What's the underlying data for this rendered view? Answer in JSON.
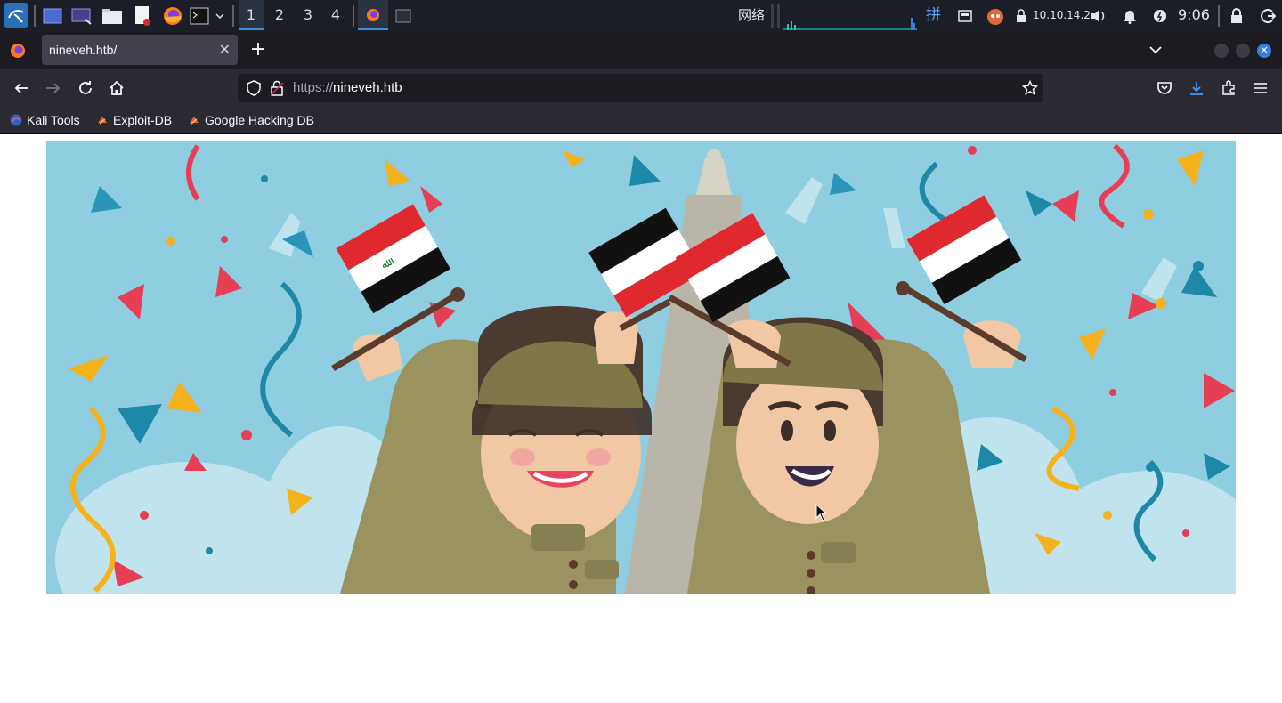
{
  "taskbar": {
    "workspaces": [
      "1",
      "2",
      "3",
      "4"
    ],
    "active_workspace": "1",
    "network_label": "网络",
    "input_method": "拼",
    "ip_address": "10.10.14.2",
    "clock": "9:06",
    "colors": {
      "accent": "#3a8fe0",
      "graph": "#1ec8c8",
      "background": "#1b1e26"
    }
  },
  "browser": {
    "tab": {
      "title": "nineveh.htb/"
    },
    "url": {
      "scheme": "https://",
      "host": "nineveh.htb"
    },
    "bookmarks": [
      {
        "label": "Kali Tools",
        "icon": "kali-icon"
      },
      {
        "label": "Exploit-DB",
        "icon": "exploit-db-icon"
      },
      {
        "label": "Google Hacking DB",
        "icon": "ghdb-icon"
      }
    ],
    "colors": {
      "toolbar": "#2b2a33",
      "tabbar": "#1c1b22",
      "download_accent": "#3b9cff"
    }
  },
  "page": {
    "hero_image": "celebration-illustration",
    "hero_colors": {
      "sky": "#8fcde0",
      "uniform": "#9a9360",
      "helmet": "#7f7748",
      "flag_red": "#e0282f",
      "flag_black": "#111111"
    }
  }
}
